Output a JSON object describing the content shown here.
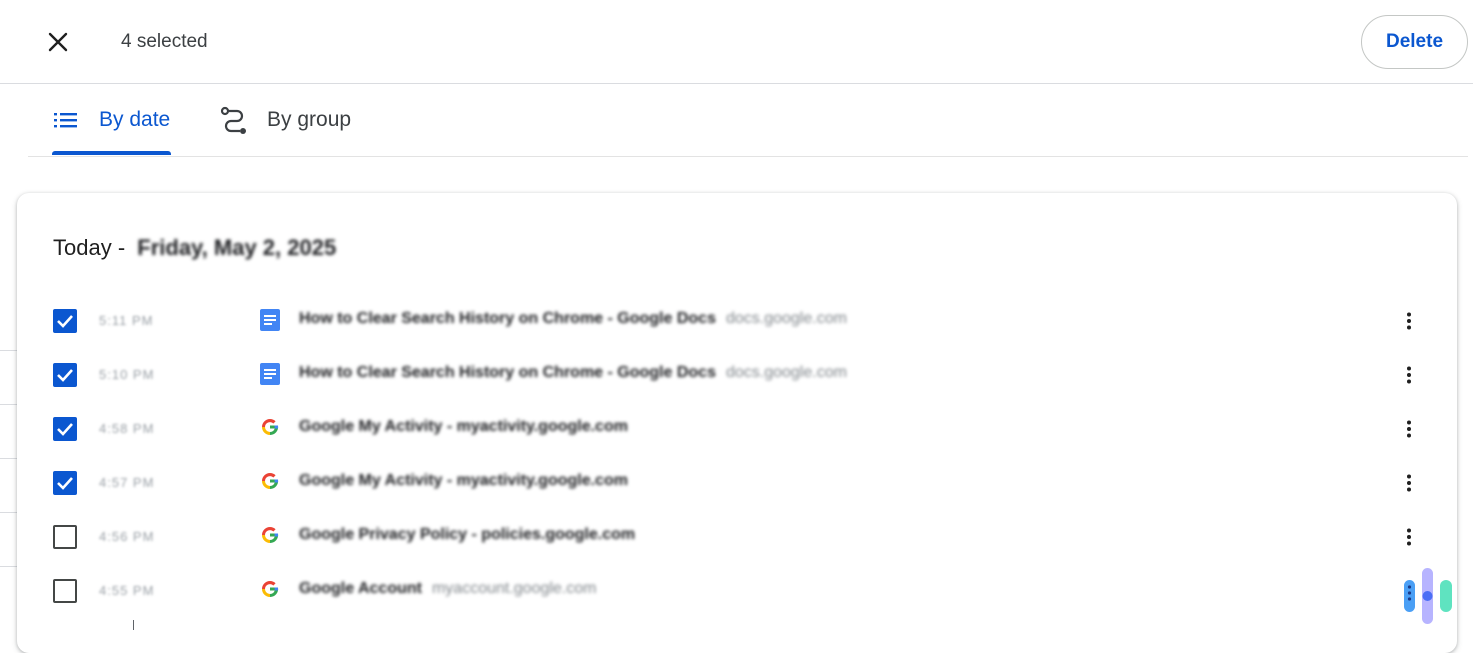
{
  "selection_bar": {
    "selected_label": "4 selected",
    "close_icon": "close-icon",
    "delete_label": "Delete"
  },
  "tabs": [
    {
      "label": "By date",
      "icon": "list-icon",
      "active": true
    },
    {
      "label": "By group",
      "icon": "journeys-icon",
      "active": false
    }
  ],
  "history_card": {
    "heading_prefix": "Today - ",
    "heading_date": "Friday, May 2, 2025",
    "entries": [
      {
        "checked": true,
        "time": "5:11 PM",
        "favicon": "google-docs-icon",
        "title": "How to Clear Search History on Chrome - Google Docs",
        "domain": "docs.google.com"
      },
      {
        "checked": true,
        "time": "5:10 PM",
        "favicon": "google-docs-icon",
        "title": "How to Clear Search History on Chrome - Google Docs",
        "domain": "docs.google.com"
      },
      {
        "checked": true,
        "time": "4:58 PM",
        "favicon": "google-icon",
        "title": "Google My Activity - myactivity.google.com",
        "domain": ""
      },
      {
        "checked": true,
        "time": "4:57 PM",
        "favicon": "google-icon",
        "title": "Google My Activity - myactivity.google.com",
        "domain": ""
      },
      {
        "checked": false,
        "time": "4:56 PM",
        "favicon": "google-icon",
        "title": "Google Privacy Policy - policies.google.com",
        "domain": ""
      },
      {
        "checked": false,
        "time": "4:55 PM",
        "favicon": "google-icon",
        "title": "Google Account",
        "domain": "myaccount.google.com"
      }
    ]
  },
  "colors": {
    "accent": "#0b57d0",
    "checkbox_checked": "#0b57d0",
    "divider": "#dadce0"
  }
}
